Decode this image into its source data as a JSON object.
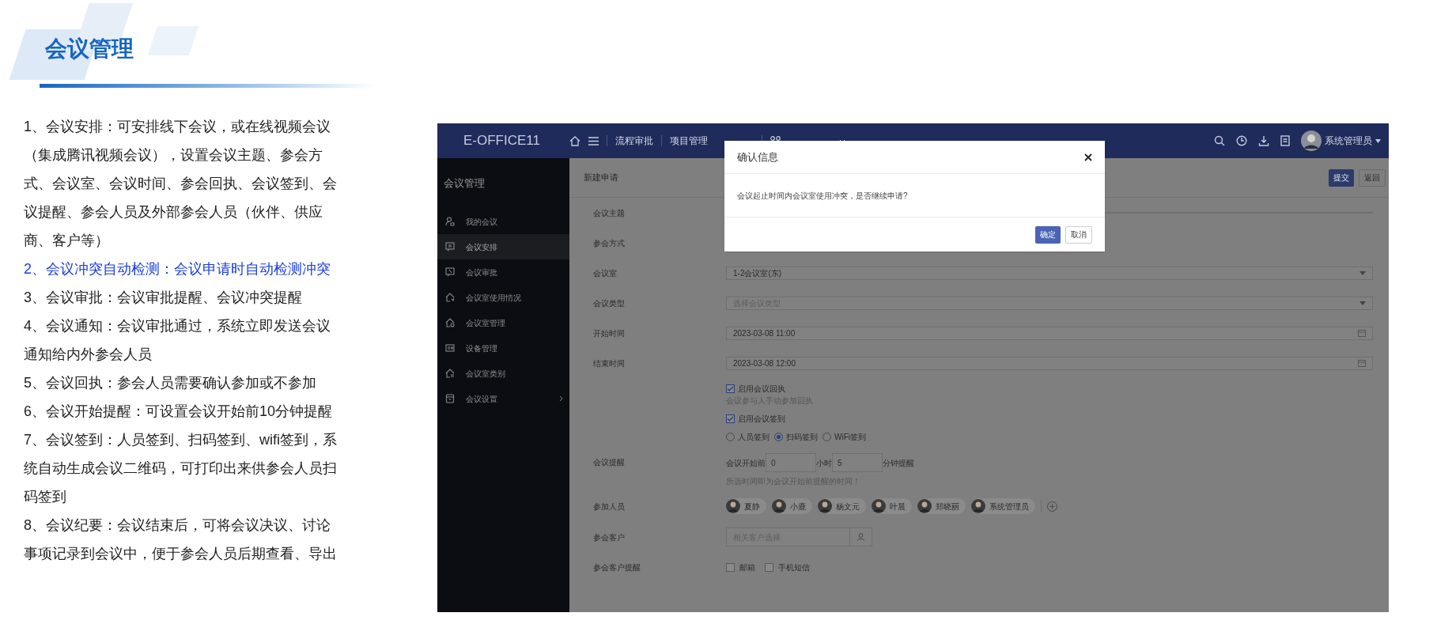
{
  "slide": {
    "title": "会议管理",
    "points": [
      {
        "text": "1、会议安排：可安排线下会议，或在线视频会议（集成腾讯视频会议），设置会议主题、参会方式、会议室、会议时间、参会回执、会议签到、会议提醒、参会人员及外部参会人员（伙伴、供应商、客户等）",
        "highlighted": false
      },
      {
        "text": "2、会议冲突自动检测：会议申请时自动检测冲突",
        "highlighted": true
      },
      {
        "text": "3、会议审批：会议审批提醒、会议冲突提醒",
        "highlighted": false
      },
      {
        "text": "4、会议通知：会议审批通过，系统立即发送会议通知给内外参会人员",
        "highlighted": false
      },
      {
        "text": "5、会议回执：参会人员需要确认参加或不参加",
        "highlighted": false
      },
      {
        "text": "6、会议开始提醒：可设置会议开始前10分钟提醒",
        "highlighted": false
      },
      {
        "text": "7、会议签到：人员签到、扫码签到、wifi签到，系统自动生成会议二维码，可打印出来供参会人员扫码签到",
        "highlighted": false
      },
      {
        "text": "8、会议纪要：会议结束后，可将会议决议、讨论事项记录到会议中，便于参会人员后期查看、导出",
        "highlighted": false
      }
    ]
  },
  "app": {
    "logo": "E-OFFICE11",
    "nav": [
      "流程审批",
      "项目管理"
    ],
    "user": "系统管理员",
    "sidebar": {
      "title": "会议管理",
      "items": [
        {
          "label": "我的会议",
          "selected": false,
          "has_children": false
        },
        {
          "label": "会议安排",
          "selected": true,
          "has_children": false
        },
        {
          "label": "会议审批",
          "selected": false,
          "has_children": false
        },
        {
          "label": "会议室使用情况",
          "selected": false,
          "has_children": false
        },
        {
          "label": "会议室管理",
          "selected": false,
          "has_children": false
        },
        {
          "label": "设备管理",
          "selected": false,
          "has_children": false
        },
        {
          "label": "会议室类别",
          "selected": false,
          "has_children": false
        },
        {
          "label": "会议设置",
          "selected": false,
          "has_children": true
        }
      ]
    },
    "page": {
      "title": "新建申请",
      "buttons": [
        {
          "label": "提交",
          "primary": true
        },
        {
          "label": "返回",
          "primary": false
        }
      ],
      "fields": [
        {
          "kind": "text",
          "label": "会议主题"
        },
        {
          "kind": "blank",
          "label": "参会方式"
        },
        {
          "kind": "select",
          "label": "会议室",
          "value": "1-2会议室(东)"
        },
        {
          "kind": "select",
          "label": "会议类型",
          "placeholder": "选择会议类型"
        },
        {
          "kind": "date",
          "label": "开始时间",
          "value": "2023-03-08 11:00"
        },
        {
          "kind": "date",
          "label": "结束时间",
          "value": "2023-03-08 12:00"
        },
        {
          "kind": "options",
          "checks": [
            {
              "label": "启用会议回执",
              "checked": true,
              "note": "会议参与人手动参加回执"
            },
            {
              "label": "启用会议签到",
              "checked": true
            }
          ],
          "radios": [
            {
              "label": "人员签到",
              "selected": false
            },
            {
              "label": "扫码签到",
              "selected": true
            },
            {
              "label": "WiFi签到",
              "selected": false
            }
          ]
        },
        {
          "kind": "reminder",
          "label": "会议提醒",
          "before": "会议开始前",
          "hours": "0",
          "hours_unit": "小时",
          "minutes": "5",
          "minutes_unit": "分钟提醒",
          "hint": "所选时间即为会议开始前提醒的时间！"
        },
        {
          "kind": "people",
          "label": "参加人员",
          "people": [
            "夏静",
            "小鹿",
            "杨文元",
            "叶晨",
            "郑晓丽",
            "系统管理员"
          ]
        },
        {
          "kind": "lookup",
          "label": "参会客户",
          "placeholder": "相关客户选择"
        },
        {
          "kind": "checks",
          "label": "参会客户提醒",
          "options": [
            {
              "label": "邮箱",
              "checked": false
            },
            {
              "label": "手机短信",
              "checked": false
            }
          ]
        }
      ]
    },
    "dialog": {
      "title": "确认信息",
      "message": "会议起止时间内会议室使用冲突，是否继续申请?",
      "confirm": "确定",
      "cancel": "取消"
    }
  }
}
